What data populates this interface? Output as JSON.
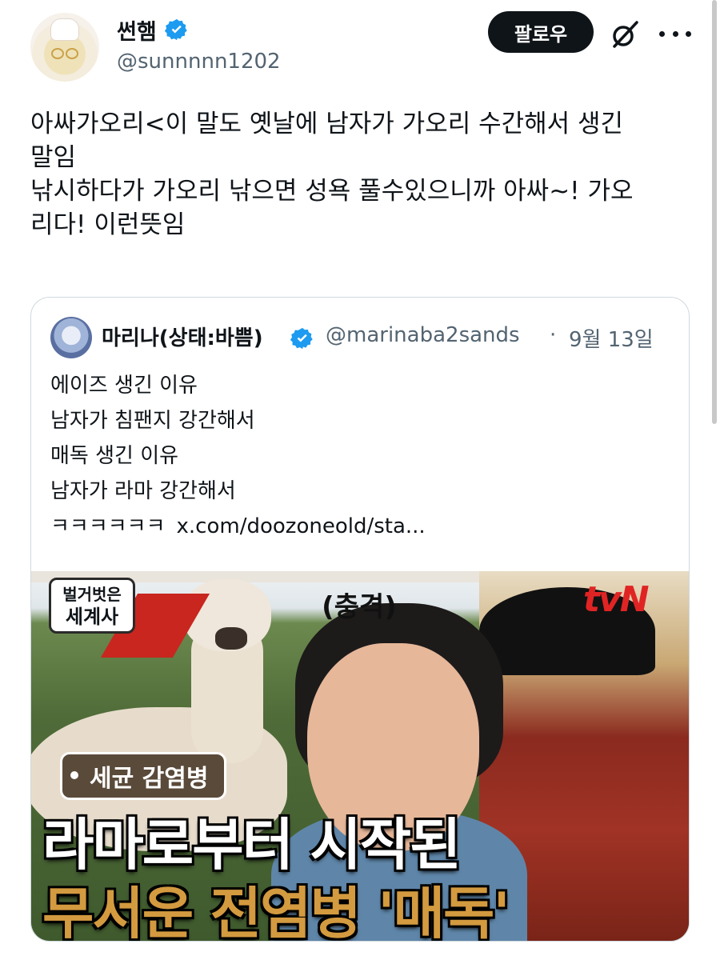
{
  "author": {
    "name": "썬햄",
    "handle": "@sunnnnn1202",
    "follow_label": "팔로우",
    "avatar_icon": "duck-avatar-icon",
    "verified_icon": "verified-badge-icon"
  },
  "tweet": {
    "lines": [
      "아싸가오리<이 말도 옛날에 남자가 가오리 수간해서 생긴",
      "말임",
      "낚시하다가 가오리 낚으면 성욕 풀수있으니까 아싸~! 가오",
      "리다! 이런뜻임"
    ]
  },
  "quote": {
    "name": "마리나(상태:바쁨)",
    "handle": "@marinaba2sands",
    "separator": "·",
    "date": "9월 13일",
    "lines": [
      "에이즈 생긴 이유",
      "남자가 침팬지 강간해서",
      "매독 생긴 이유",
      "남자가 라마 강간해서"
    ],
    "last_line_prefix": "ㅋㅋㅋㅋㅋㅋ",
    "link": "x.com/doozoneold/sta...",
    "thumbnail": {
      "badge_line1": "벌거벗은",
      "badge_line2": "세계사",
      "shock_label": "(충격)",
      "network": "tvN",
      "tag": "세균 감염병",
      "title_line1": "라마로부터 시작된",
      "title_line2": "무서운 전염병 '매독'"
    }
  },
  "colors": {
    "text": "#0f1419",
    "muted": "#536471",
    "verified": "#1d9bf0",
    "follow_bg": "#0f1419",
    "accent_red": "#e02424",
    "title_gold": "#d39a3f"
  }
}
